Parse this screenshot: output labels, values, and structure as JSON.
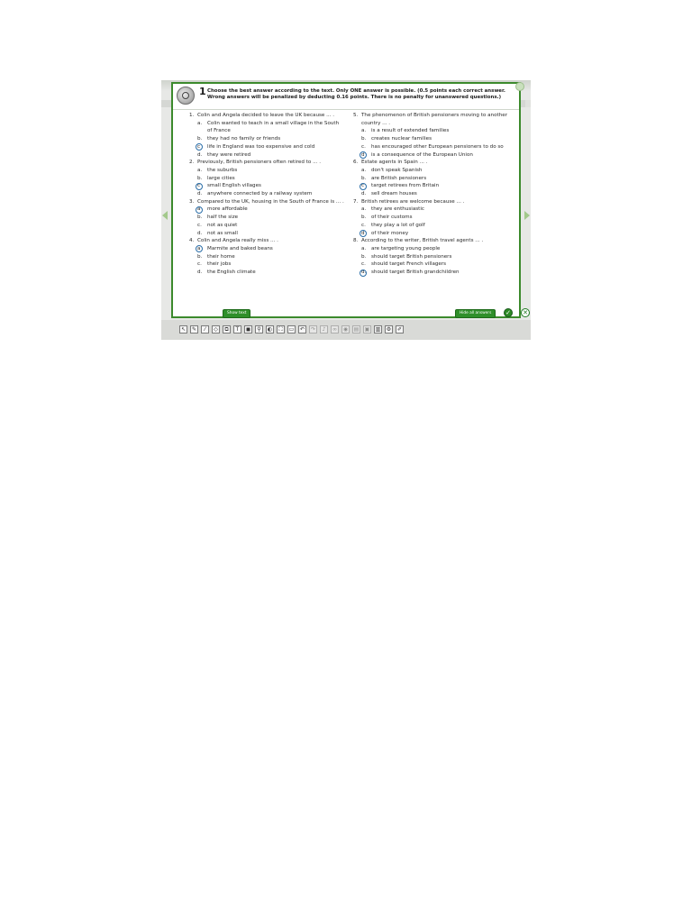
{
  "exercise": {
    "number": "1",
    "instruction_line1": "Choose the best answer according to the text. Only ONE answer is possible. (0.5 points each correct answer.",
    "instruction_line2": "Wrong answers will be penalized by deducting 0.16 points. There is no penalty for unanswered questions.)"
  },
  "questions": [
    {
      "num": "1.",
      "text": "Colin and Angela decided to leave the UK because ... .",
      "options": [
        {
          "letter": "a.",
          "text": "Colin wanted to teach in a small village in the South of France",
          "selected": false
        },
        {
          "letter": "b.",
          "text": "they had no family or friends",
          "selected": false
        },
        {
          "letter": "c",
          "text": "life in England was too expensive and cold",
          "selected": true
        },
        {
          "letter": "d.",
          "text": "they were retired",
          "selected": false
        }
      ]
    },
    {
      "num": "2.",
      "text": "Previously, British pensioners often retired to ... .",
      "options": [
        {
          "letter": "a.",
          "text": "the suburbs",
          "selected": false
        },
        {
          "letter": "b.",
          "text": "large cities",
          "selected": false
        },
        {
          "letter": "c",
          "text": "small English villages",
          "selected": true
        },
        {
          "letter": "d.",
          "text": "anywhere connected by a railway system",
          "selected": false
        }
      ]
    },
    {
      "num": "3.",
      "text": "Compared to the UK, housing in the South of France is ... .",
      "options": [
        {
          "letter": "a",
          "text": "more affordable",
          "selected": true
        },
        {
          "letter": "b.",
          "text": "half the size",
          "selected": false
        },
        {
          "letter": "c.",
          "text": "not as quiet",
          "selected": false
        },
        {
          "letter": "d.",
          "text": "not as small",
          "selected": false
        }
      ]
    },
    {
      "num": "4.",
      "text": "Colin and Angela really miss ... .",
      "options": [
        {
          "letter": "a",
          "text": "Marmite and baked beans",
          "selected": true
        },
        {
          "letter": "b.",
          "text": "their home",
          "selected": false
        },
        {
          "letter": "c.",
          "text": "their jobs",
          "selected": false
        },
        {
          "letter": "d.",
          "text": "the English climate",
          "selected": false
        }
      ]
    },
    {
      "num": "5.",
      "text": "The phenomenon of British pensioners moving to another country ... .",
      "options": [
        {
          "letter": "a.",
          "text": "is a result of extended families",
          "selected": false
        },
        {
          "letter": "b.",
          "text": "creates nuclear families",
          "selected": false
        },
        {
          "letter": "c.",
          "text": "has encouraged other European pensioners to do so",
          "selected": false
        },
        {
          "letter": "d",
          "text": "is a consequence of the European Union",
          "selected": true
        }
      ]
    },
    {
      "num": "6.",
      "text": "Estate agents in Spain ... .",
      "options": [
        {
          "letter": "a.",
          "text": "don't speak Spanish",
          "selected": false
        },
        {
          "letter": "b.",
          "text": "are British pensioners",
          "selected": false
        },
        {
          "letter": "c",
          "text": "target retirees from Britain",
          "selected": true
        },
        {
          "letter": "d.",
          "text": "sell dream houses",
          "selected": false
        }
      ]
    },
    {
      "num": "7.",
      "text": "British retirees are welcome because ... .",
      "options": [
        {
          "letter": "a.",
          "text": "they are enthusiastic",
          "selected": false
        },
        {
          "letter": "b.",
          "text": "of their customs",
          "selected": false
        },
        {
          "letter": "c.",
          "text": "they play a lot of golf",
          "selected": false
        },
        {
          "letter": "d",
          "text": "of their money",
          "selected": true
        }
      ]
    },
    {
      "num": "8.",
      "text": "According to the writer, British travel agents ... .",
      "options": [
        {
          "letter": "a.",
          "text": "are targeting young people",
          "selected": false
        },
        {
          "letter": "b.",
          "text": "should target British pensioners",
          "selected": false
        },
        {
          "letter": "c.",
          "text": "should target French villagers",
          "selected": false
        },
        {
          "letter": "d.",
          "text": "should target British grandchildren",
          "selected": true
        }
      ]
    }
  ],
  "buttons": {
    "show_text": "Show text",
    "hide_answers": "Hide all answers"
  },
  "toolbar": {
    "tools": [
      {
        "icon": "pointer-icon",
        "glyph": "↖",
        "enabled": true
      },
      {
        "icon": "pen-icon",
        "glyph": "✎",
        "enabled": true
      },
      {
        "icon": "highlighter-icon",
        "glyph": "⁄",
        "enabled": true
      },
      {
        "icon": "eraser-icon",
        "glyph": "◇",
        "enabled": true
      },
      {
        "icon": "copy-icon",
        "glyph": "⧉",
        "enabled": true
      },
      {
        "icon": "text-icon",
        "glyph": "T",
        "enabled": true
      },
      {
        "icon": "shape-icon",
        "glyph": "◼",
        "enabled": true
      },
      {
        "icon": "zoom-icon",
        "glyph": "⚲",
        "enabled": true
      },
      {
        "icon": "spotlight-icon",
        "glyph": "◐",
        "enabled": true
      },
      {
        "icon": "fullscreen-icon",
        "glyph": "⛶",
        "enabled": true
      },
      {
        "icon": "screen-icon",
        "glyph": "▭",
        "enabled": true
      },
      {
        "icon": "undo-icon",
        "glyph": "↶",
        "enabled": true
      },
      {
        "icon": "redo-icon",
        "glyph": "↷",
        "enabled": false
      },
      {
        "icon": "audio-icon",
        "glyph": "♪",
        "enabled": false
      },
      {
        "icon": "link-icon",
        "glyph": "∞",
        "enabled": false
      },
      {
        "icon": "view-icon",
        "glyph": "◉",
        "enabled": false
      },
      {
        "icon": "folder-icon",
        "glyph": "▤",
        "enabled": false
      },
      {
        "icon": "save-icon",
        "glyph": "▣",
        "enabled": false
      },
      {
        "icon": "print-icon",
        "glyph": "▥",
        "enabled": true
      },
      {
        "icon": "settings-icon",
        "glyph": "⚙",
        "enabled": true
      },
      {
        "icon": "brush-icon",
        "glyph": "✐",
        "enabled": true
      }
    ]
  },
  "colors": {
    "accent": "#3c8a2c",
    "answer_circle": "#2b6ea8"
  }
}
